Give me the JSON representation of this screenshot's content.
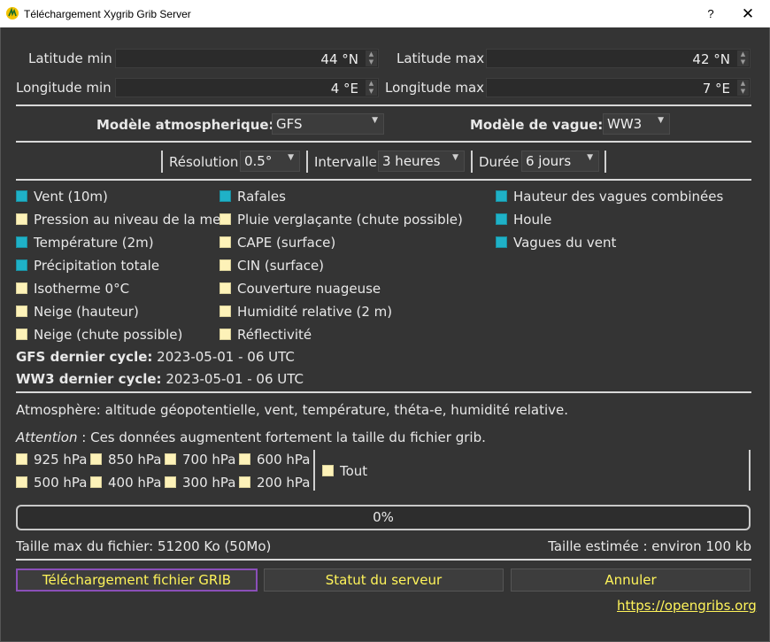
{
  "window": {
    "title": "Téléchargement Xygrib Grib Server",
    "help": "?",
    "close": "✕"
  },
  "area": {
    "lat_min_label": "Latitude min",
    "lat_min_value": "44 °N",
    "lat_max_label": "Latitude max",
    "lat_max_value": "42 °N",
    "lon_min_label": "Longitude min",
    "lon_min_value": "4 °E",
    "lon_max_label": "Longitude max",
    "lon_max_value": "7 °E"
  },
  "models": {
    "atmo_label": "Modèle atmospherique:",
    "atmo_value": "GFS",
    "wave_label": "Modèle de vague:",
    "wave_value": "WW3"
  },
  "params": {
    "resolution_label": "Résolution",
    "resolution_value": "0.5°",
    "interval_label": "Intervalle",
    "interval_value": "3 heures",
    "duration_label": "Durée",
    "duration_value": "6 jours"
  },
  "checks": {
    "col1": [
      {
        "label": "Vent (10m)",
        "checked": true
      },
      {
        "label": "Pression au niveau de la mer",
        "checked": false
      },
      {
        "label": "Température (2m)",
        "checked": true
      },
      {
        "label": "Précipitation totale",
        "checked": true
      },
      {
        "label": "Isotherme 0°C",
        "checked": false
      },
      {
        "label": "Neige (hauteur)",
        "checked": false
      },
      {
        "label": "Neige (chute possible)",
        "checked": false
      }
    ],
    "col2": [
      {
        "label": "Rafales",
        "checked": true
      },
      {
        "label": "Pluie verglaçante (chute possible)",
        "checked": false
      },
      {
        "label": "CAPE (surface)",
        "checked": false
      },
      {
        "label": "CIN (surface)",
        "checked": false
      },
      {
        "label": "Couverture nuageuse",
        "checked": false
      },
      {
        "label": "Humidité relative (2 m)",
        "checked": false
      },
      {
        "label": "Réflectivité",
        "checked": false
      }
    ],
    "col3": [
      {
        "label": "Hauteur des vagues combinées",
        "checked": true
      },
      {
        "label": "Houle",
        "checked": true
      },
      {
        "label": "Vagues du vent",
        "checked": true
      }
    ]
  },
  "cycles": {
    "gfs_label": "GFS dernier cycle:",
    "gfs_value": " 2023-05-01 - 06 UTC",
    "ww3_label": "WW3 dernier cycle:",
    "ww3_value": " 2023-05-01 - 06 UTC"
  },
  "atmosphere": {
    "description": "Atmosphère: altitude géopotentielle, vent, température, théta-e, humidité relative.",
    "warning_prefix": "Attention",
    "warning_text": " : Ces données augmentent fortement la taille du fichier grib.",
    "levels": [
      {
        "label": "925 hPa",
        "checked": false
      },
      {
        "label": "850 hPa",
        "checked": false
      },
      {
        "label": "700 hPa",
        "checked": false
      },
      {
        "label": "600 hPa",
        "checked": false
      },
      {
        "label": "500 hPa",
        "checked": false
      },
      {
        "label": "400 hPa",
        "checked": false
      },
      {
        "label": "300 hPa",
        "checked": false
      },
      {
        "label": "200 hPa",
        "checked": false
      }
    ],
    "all_label": "Tout"
  },
  "progress": {
    "text": "0%",
    "value": 0
  },
  "sizes": {
    "max": "Taille max du fichier: 51200 Ko (50Mo)",
    "estimated": "Taille estimée : environ 100 kb"
  },
  "buttons": {
    "download": "Téléchargement fichier GRIB",
    "status": "Statut du serveur",
    "cancel": "Annuler"
  },
  "link": "https://opengribs.org",
  "colors": {
    "checked": "#1fb1c7",
    "unchecked": "#fdf2b8",
    "button_text": "#fff45a",
    "background": "#343434"
  }
}
